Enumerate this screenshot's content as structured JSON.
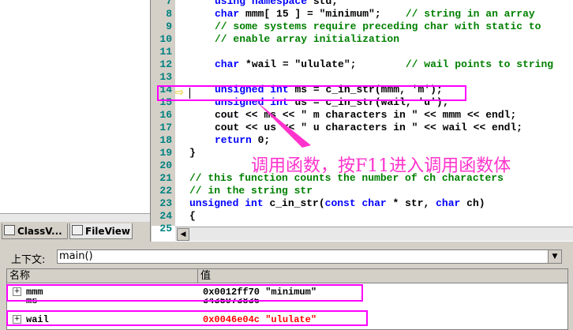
{
  "workspace": {
    "tabs": [
      {
        "label": "ClassV..."
      },
      {
        "label": "FileView"
      }
    ]
  },
  "editor": {
    "lines": [
      {
        "num": "7",
        "code": "using namespace std;"
      },
      {
        "num": "8",
        "code": "char mmm[ 15 ] = \"minimum\";    // string in an array"
      },
      {
        "num": "9",
        "code": "// some systems require preceding char with static to"
      },
      {
        "num": "10",
        "code": "// enable array initialization"
      },
      {
        "num": "11",
        "code": ""
      },
      {
        "num": "12",
        "code": "char *wail = \"ululate\";        // wail points to string"
      },
      {
        "num": "13",
        "code": ""
      },
      {
        "num": "14",
        "code": "unsigned int ms = c_in_str(mmm, 'm');"
      },
      {
        "num": "15",
        "code": "unsigned int us = c_in_str(wail, 'u');"
      },
      {
        "num": "16",
        "code": "cout << ms << \" m characters in \" << mmm << endl;"
      },
      {
        "num": "17",
        "code": "cout << us << \" u characters in \" << wail << endl;"
      },
      {
        "num": "18",
        "code": "return 0;"
      },
      {
        "num": "19",
        "code": "}"
      },
      {
        "num": "20",
        "code": ""
      },
      {
        "num": "21",
        "code": "// this function counts the number of ch characters"
      },
      {
        "num": "22",
        "code": "// in the string str"
      },
      {
        "num": "23",
        "code": "unsigned int c_in_str(const char * str, char ch)"
      },
      {
        "num": "24",
        "code": "{"
      },
      {
        "num": "25",
        "code": ""
      }
    ],
    "annotation": "调用函数，按F11进入调用函数体"
  },
  "context": {
    "label": "上下文:",
    "value": "main()"
  },
  "variables": {
    "headers": [
      "名称",
      "值"
    ],
    "rows": [
      {
        "name": "mmm",
        "value": "0x0012ff70 \"minimum\"",
        "expandable": true,
        "changed": false
      },
      {
        "name": "ms",
        "value": "3435973836",
        "expandable": false,
        "changed": false
      },
      {
        "name": "wail",
        "value": "0x0046e04c \"ululate\"",
        "expandable": true,
        "changed": true
      }
    ]
  },
  "colors": {
    "highlight": "#ff00ff",
    "keyword": "#0000ff",
    "comment": "#008000",
    "line_number": "#008080",
    "changed_value": "#ff0000"
  }
}
